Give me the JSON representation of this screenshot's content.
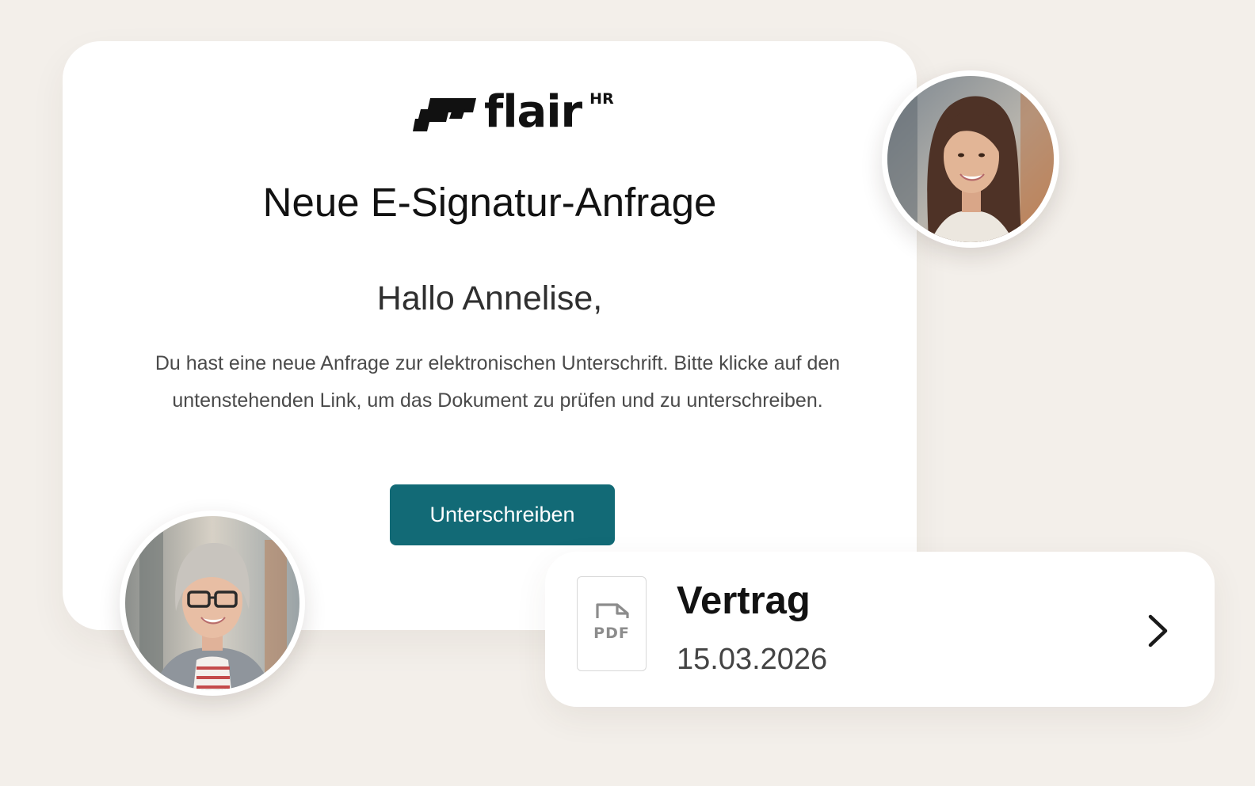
{
  "brand": {
    "name": "flair",
    "badge": "HR"
  },
  "email": {
    "title": "Neue E-Signatur-Anfrage",
    "greeting": "Hallo Annelise,",
    "body": "Du hast eine neue Anfrage zur elektronischen Unterschrift. Bitte klicke auf den untenstehenden Link, um das Dokument zu prüfen und zu unterschreiben.",
    "button_label": "Unterschreiben",
    "button_color": "#126a76"
  },
  "document": {
    "file_type": "PDF",
    "name": "Vertrag",
    "date": "15.03.2026"
  },
  "icons": {
    "logo": "flair-logo-icon",
    "file": "pdf-file-icon",
    "chevron": "chevron-right-icon"
  },
  "colors": {
    "background": "#f3efea",
    "card": "#ffffff",
    "accent": "#126a76"
  }
}
